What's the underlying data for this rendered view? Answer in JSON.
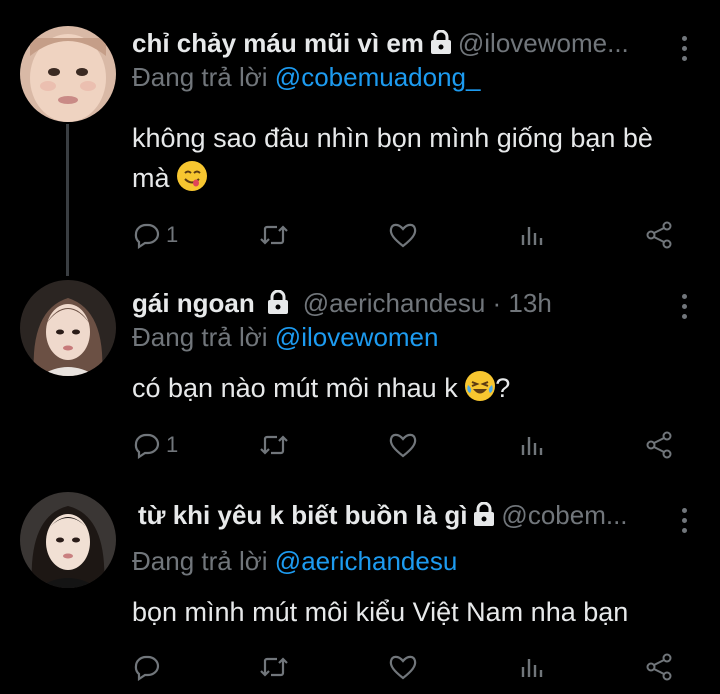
{
  "tweets": [
    {
      "name": "chỉ chảy máu mũi vì em",
      "handle": "@ilovewome...",
      "replying_prefix": "Đang trả lời",
      "replying_to": "@cobemuadong_",
      "text_line1": "không sao đâu nhìn bọn mình giống bạn bè",
      "text_line2": "mà",
      "emoji": "yum-face-emoji",
      "reply_count": "1",
      "retweet_count": "",
      "like_count": ""
    },
    {
      "name": "gái ngoan",
      "handle": "@aerichandesu · 13h",
      "replying_prefix": "Đang trả lời",
      "replying_to": "@ilovewomen",
      "text_line1": "có bạn nào mút môi nhau k",
      "text_after_emoji": "?",
      "emoji": "joy-face-emoji",
      "reply_count": "1",
      "retweet_count": "",
      "like_count": ""
    },
    {
      "name": "từ khi yêu k biết buồn là gì",
      "handle": "@cobem...",
      "replying_prefix": "Đang trả lời",
      "replying_to": "@aerichandesu",
      "text_line1": "bọn mình mút môi kiểu Việt Nam nha bạn",
      "reply_count": "",
      "retweet_count": "",
      "like_count": ""
    }
  ],
  "colors": {
    "background": "#000000",
    "primary_text": "#e7e9ea",
    "secondary_text": "#71767b",
    "link": "#1d9bf0",
    "thread_line": "#3a3e42"
  },
  "icons": [
    "lock-icon",
    "more-icon",
    "reply-icon",
    "retweet-icon",
    "like-icon",
    "views-icon",
    "share-icon"
  ]
}
